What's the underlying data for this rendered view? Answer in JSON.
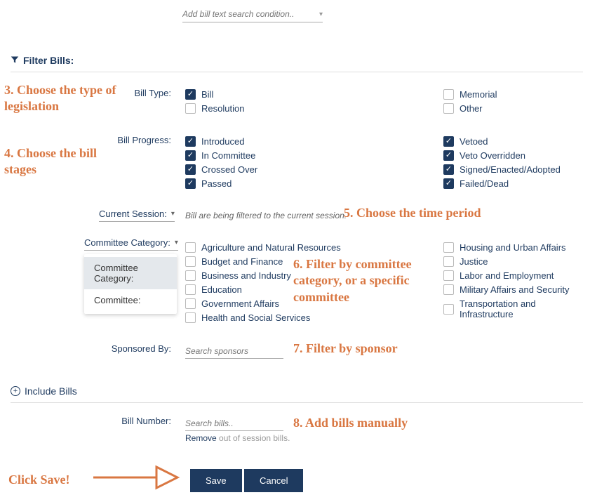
{
  "topSearch": {
    "placeholder": "Add bill text search condition.."
  },
  "filterHeader": "Filter Bills:",
  "billType": {
    "label": "Bill Type:",
    "left": [
      {
        "label": "Bill",
        "checked": true
      },
      {
        "label": "Resolution",
        "checked": false
      }
    ],
    "right": [
      {
        "label": "Memorial",
        "checked": false
      },
      {
        "label": "Other",
        "checked": false
      }
    ]
  },
  "billProgress": {
    "label": "Bill Progress:",
    "left": [
      {
        "label": "Introduced",
        "checked": true
      },
      {
        "label": "In Committee",
        "checked": true
      },
      {
        "label": "Crossed Over",
        "checked": true
      },
      {
        "label": "Passed",
        "checked": true
      }
    ],
    "right": [
      {
        "label": "Vetoed",
        "checked": true
      },
      {
        "label": "Veto Overridden",
        "checked": true
      },
      {
        "label": "Signed/Enacted/Adopted",
        "checked": true
      },
      {
        "label": "Failed/Dead",
        "checked": true
      }
    ]
  },
  "session": {
    "label": "Current Session:",
    "info": "Bill are being filtered to the current session."
  },
  "committee": {
    "label": "Committee Category:",
    "popup": [
      "Committee Category:",
      "Committee:"
    ],
    "left": [
      {
        "label": "Agriculture and Natural Resources",
        "checked": false
      },
      {
        "label": "Budget and Finance",
        "checked": false
      },
      {
        "label": "Business and Industry",
        "checked": false
      },
      {
        "label": "Education",
        "checked": false
      },
      {
        "label": "Government Affairs",
        "checked": false
      },
      {
        "label": "Health and Social Services",
        "checked": false
      }
    ],
    "right": [
      {
        "label": "Housing and Urban Affairs",
        "checked": false
      },
      {
        "label": "Justice",
        "checked": false
      },
      {
        "label": "Labor and Employment",
        "checked": false
      },
      {
        "label": "Military Affairs and Security",
        "checked": false
      },
      {
        "label": "Transportation and Infrastructure",
        "checked": false
      }
    ]
  },
  "sponsored": {
    "label": "Sponsored By:",
    "placeholder": "Search sponsors"
  },
  "includeHeader": "Include Bills",
  "billNumber": {
    "label": "Bill Number:",
    "placeholder": "Search bills.."
  },
  "removeLine": {
    "link": "Remove",
    "rest": " out of session bills."
  },
  "buttons": {
    "save": "Save",
    "cancel": "Cancel"
  },
  "annotations": {
    "a3": "3. Choose the type of legislation",
    "a4": "4. Choose the bill stages",
    "a5": "5. Choose the time period",
    "a6": "6. Filter by committee category, or a specific committee",
    "a7": "7. Filter by sponsor",
    "a8": "8. Add bills manually",
    "aSave": "Click Save!"
  }
}
